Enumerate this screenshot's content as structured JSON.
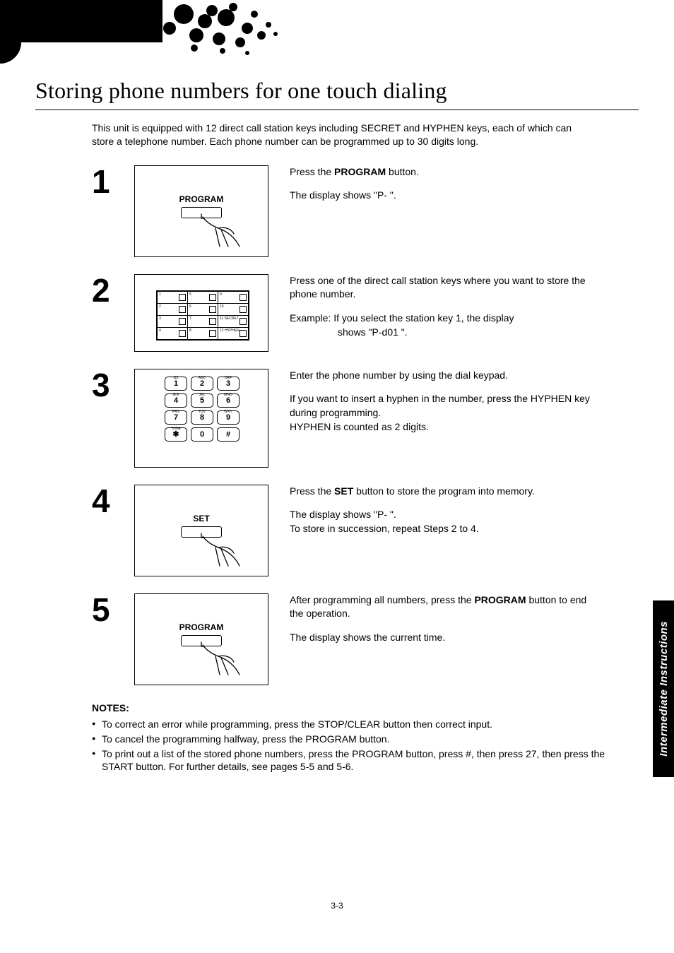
{
  "title": "Storing phone numbers for one touch dialing",
  "intro": "This unit is equipped with 12 direct call station keys including SECRET and HYPHEN keys, each of which can store a telephone number. Each phone number can be programmed up to 30 digits long.",
  "steps": [
    {
      "num": "1",
      "button_label": "PROGRAM",
      "lines": [
        "Press the <b>PROGRAM</b> button.",
        "The display shows \"P- \"."
      ]
    },
    {
      "num": "2",
      "station_labels": [
        "1",
        "5",
        "9",
        "2",
        "6",
        "10",
        "3",
        "7",
        "11 SECRET",
        "4",
        "8",
        "12 HYPHEN"
      ],
      "lines": [
        "Press one of the direct call station keys where you want to store the phone number.",
        "Example: If you select the station key 1, the display<br><span class=\"indent\">shows \"P-d01 \".</span>"
      ]
    },
    {
      "num": "3",
      "keypad": {
        "labels": [
          "QZ",
          "ABC",
          "DEF",
          "GHI",
          "JKL",
          "MNO",
          "PRS",
          "TUV",
          "WXY",
          "TONE",
          "",
          ""
        ],
        "keys": [
          "1",
          "2",
          "3",
          "4",
          "5",
          "6",
          "7",
          "8",
          "9",
          "✱",
          "0",
          "#"
        ]
      },
      "lines": [
        "Enter the phone number by using the dial keypad.",
        "If you want to insert a hyphen in the number, press the HYPHEN key during programming.<br>HYPHEN is counted as 2 digits."
      ]
    },
    {
      "num": "4",
      "button_label": "SET",
      "lines": [
        "Press the <b>SET</b> button to store the program into memory.",
        "The display shows \"P- \".<br>To store in succession, repeat Steps 2 to 4."
      ]
    },
    {
      "num": "5",
      "button_label": "PROGRAM",
      "lines": [
        "After programming all numbers, press the <b>PROGRAM</b> button to end the operation.",
        "The display shows the current time."
      ]
    }
  ],
  "notes": {
    "heading": "NOTES:",
    "items": [
      "To correct an error while programming, press the STOP/CLEAR button then correct input.",
      "To cancel the programming halfway, press the PROGRAM button.",
      "To print out a list of the stored phone numbers, press the PROGRAM button, press #, then press 27, then press the START button. For further details, see pages 5-5 and 5-6."
    ]
  },
  "side_tab": "Intermediate Instructions",
  "page_number": "3-3"
}
